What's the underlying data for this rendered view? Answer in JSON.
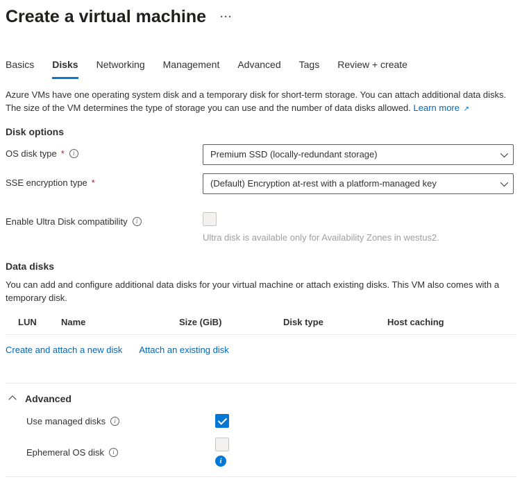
{
  "header": {
    "title": "Create a virtual machine"
  },
  "tabs": [
    {
      "label": "Basics",
      "active": false
    },
    {
      "label": "Disks",
      "active": true
    },
    {
      "label": "Networking",
      "active": false
    },
    {
      "label": "Management",
      "active": false
    },
    {
      "label": "Advanced",
      "active": false
    },
    {
      "label": "Tags",
      "active": false
    },
    {
      "label": "Review + create",
      "active": false
    }
  ],
  "intro": {
    "text": "Azure VMs have one operating system disk and a temporary disk for short-term storage. You can attach additional data disks. The size of the VM determines the type of storage you can use and the number of data disks allowed. ",
    "learn_more": "Learn more"
  },
  "disk_options": {
    "heading": "Disk options",
    "os_disk_label": "OS disk type",
    "os_disk_value": "Premium SSD (locally-redundant storage)",
    "sse_label": "SSE encryption type",
    "sse_value": "(Default) Encryption at-rest with a platform-managed key",
    "ultra_label": "Enable Ultra Disk compatibility",
    "ultra_hint": "Ultra disk is available only for Availability Zones in westus2."
  },
  "data_disks": {
    "heading": "Data disks",
    "intro": "You can add and configure additional data disks for your virtual machine or attach existing disks. This VM also comes with a temporary disk.",
    "columns": {
      "lun": "LUN",
      "name": "Name",
      "size": "Size (GiB)",
      "type": "Disk type",
      "cache": "Host caching"
    },
    "create_link": "Create and attach a new disk",
    "attach_link": "Attach an existing disk"
  },
  "advanced": {
    "heading": "Advanced",
    "managed_label": "Use managed disks",
    "managed_checked": true,
    "ephemeral_label": "Ephemeral OS disk",
    "ephemeral_checked": false
  }
}
